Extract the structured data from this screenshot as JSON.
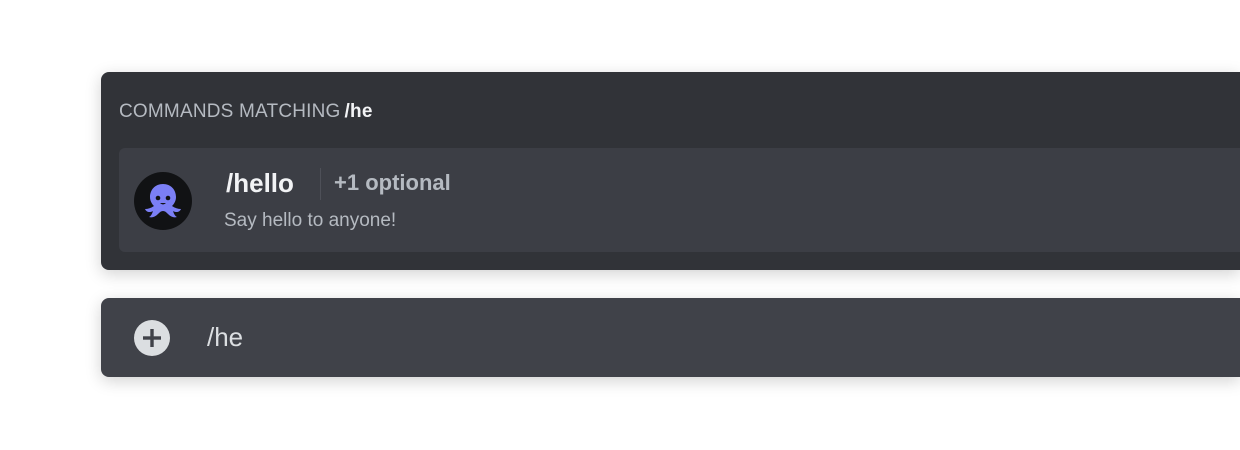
{
  "autocomplete": {
    "header_label": "COMMANDS MATCHING",
    "query": "/he",
    "items": [
      {
        "command": "/hello",
        "options": "+1 optional",
        "description": "Say hello to anyone!",
        "icon": "octopus-bot-avatar"
      }
    ]
  },
  "composer": {
    "value": "/he",
    "attach_icon": "plus-circle-icon"
  },
  "colors": {
    "accent": "#7b7ff5",
    "popup_bg": "#313338",
    "item_bg": "#3c3e45",
    "input_bg": "#404249"
  }
}
